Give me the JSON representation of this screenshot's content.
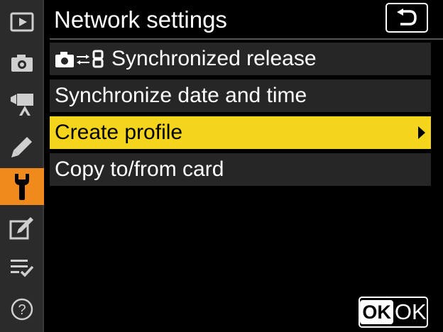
{
  "header": {
    "title": "Network settings",
    "back_icon": "return-arrow-icon"
  },
  "sidebar": {
    "tabs": [
      {
        "name": "tab-playback",
        "icon": "playback-icon",
        "active": false
      },
      {
        "name": "tab-photo-shooting",
        "icon": "camera-icon",
        "active": false
      },
      {
        "name": "tab-movie-shooting",
        "icon": "movie-camera-icon",
        "active": false
      },
      {
        "name": "tab-custom-settings",
        "icon": "pencil-icon",
        "active": false
      },
      {
        "name": "tab-setup",
        "icon": "wrench-icon",
        "active": true
      },
      {
        "name": "tab-retouch",
        "icon": "retouch-icon",
        "active": false
      },
      {
        "name": "tab-my-menu",
        "icon": "my-menu-icon",
        "active": false
      },
      {
        "name": "tab-help",
        "icon": "help-icon",
        "active": false
      }
    ]
  },
  "menu": {
    "items": [
      {
        "label": "Synchronized release",
        "icon": "camera-sync-icon",
        "selected": false
      },
      {
        "label": "Synchronize date and time",
        "selected": false
      },
      {
        "label": "Create profile",
        "selected": true,
        "has_submenu": true
      },
      {
        "label": "Copy to/from card",
        "selected": false
      }
    ]
  },
  "ok_button": {
    "badge": "OK",
    "label": "OK"
  },
  "colors": {
    "background": "#000000",
    "sidebar": "#2b2b2b",
    "active_tab": "#f08a1c",
    "selection": "#f5d51c",
    "item_bg": "#262626"
  }
}
